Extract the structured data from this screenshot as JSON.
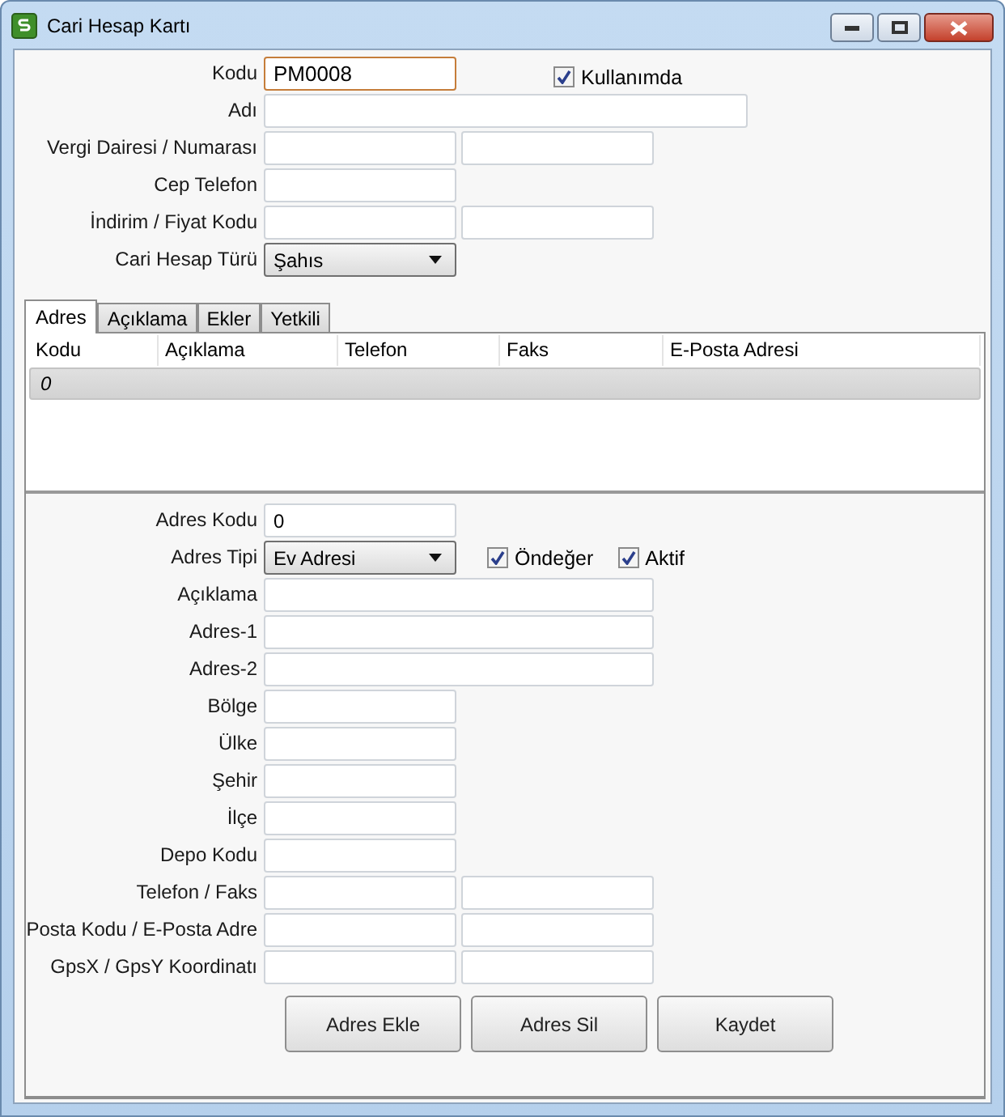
{
  "window": {
    "title": "Cari Hesap Kartı"
  },
  "header_form": [
    {
      "label": "Kodu",
      "kind": "text",
      "value": "PM0008",
      "focused": true,
      "checkbox": {
        "label": "Kullanımda",
        "checked": true
      }
    },
    {
      "label": "Adı",
      "kind": "wide",
      "focused": false
    },
    {
      "label": "Vergi Dairesi / Numarası",
      "kind": "pair",
      "focused": false
    },
    {
      "label": "Cep Telefon",
      "kind": "text",
      "focused": false
    },
    {
      "label": "İndirim / Fiyat Kodu",
      "kind": "pair",
      "focused": false
    },
    {
      "label": "Cari Hesap Türü",
      "kind": "select",
      "value": "Şahıs",
      "focused": false
    }
  ],
  "tabs": [
    {
      "label": "Adres",
      "selected": true
    },
    {
      "label": "Açıklama",
      "selected": false
    },
    {
      "label": "Ekler",
      "selected": false
    },
    {
      "label": "Yetkili",
      "selected": false
    }
  ],
  "address_table": {
    "columns": [
      "Kodu",
      "Açıklama",
      "Telefon",
      "Faks",
      "E-Posta Adresi"
    ],
    "rows": [
      [
        "0"
      ]
    ]
  },
  "address_form": [
    {
      "label": "Adres Kodu",
      "kind": "text",
      "value": "0"
    },
    {
      "label": "Adres Tipi",
      "kind": "select",
      "value": "Ev Adresi",
      "checkboxes": [
        {
          "label": "Öndeğer",
          "checked": true
        },
        {
          "label": "Aktif",
          "checked": true
        }
      ]
    },
    {
      "label": "Açıklama",
      "kind": "wide"
    },
    {
      "label": "Adres-1",
      "kind": "wide"
    },
    {
      "label": "Adres-2",
      "kind": "wide"
    },
    {
      "label": "Bölge",
      "kind": "text"
    },
    {
      "label": "Ülke",
      "kind": "text"
    },
    {
      "label": "Şehir",
      "kind": "text"
    },
    {
      "label": "İlçe",
      "kind": "text"
    },
    {
      "label": "Depo Kodu",
      "kind": "text"
    },
    {
      "label": "Telefon / Faks",
      "kind": "pair"
    },
    {
      "label": "Posta Kodu / E-Posta Adre",
      "kind": "pair"
    },
    {
      "label": "GpsX / GpsY Koordinatı",
      "kind": "pair"
    }
  ],
  "buttons": [
    "Adres Ekle",
    "Adres Sil",
    "Kaydet"
  ]
}
